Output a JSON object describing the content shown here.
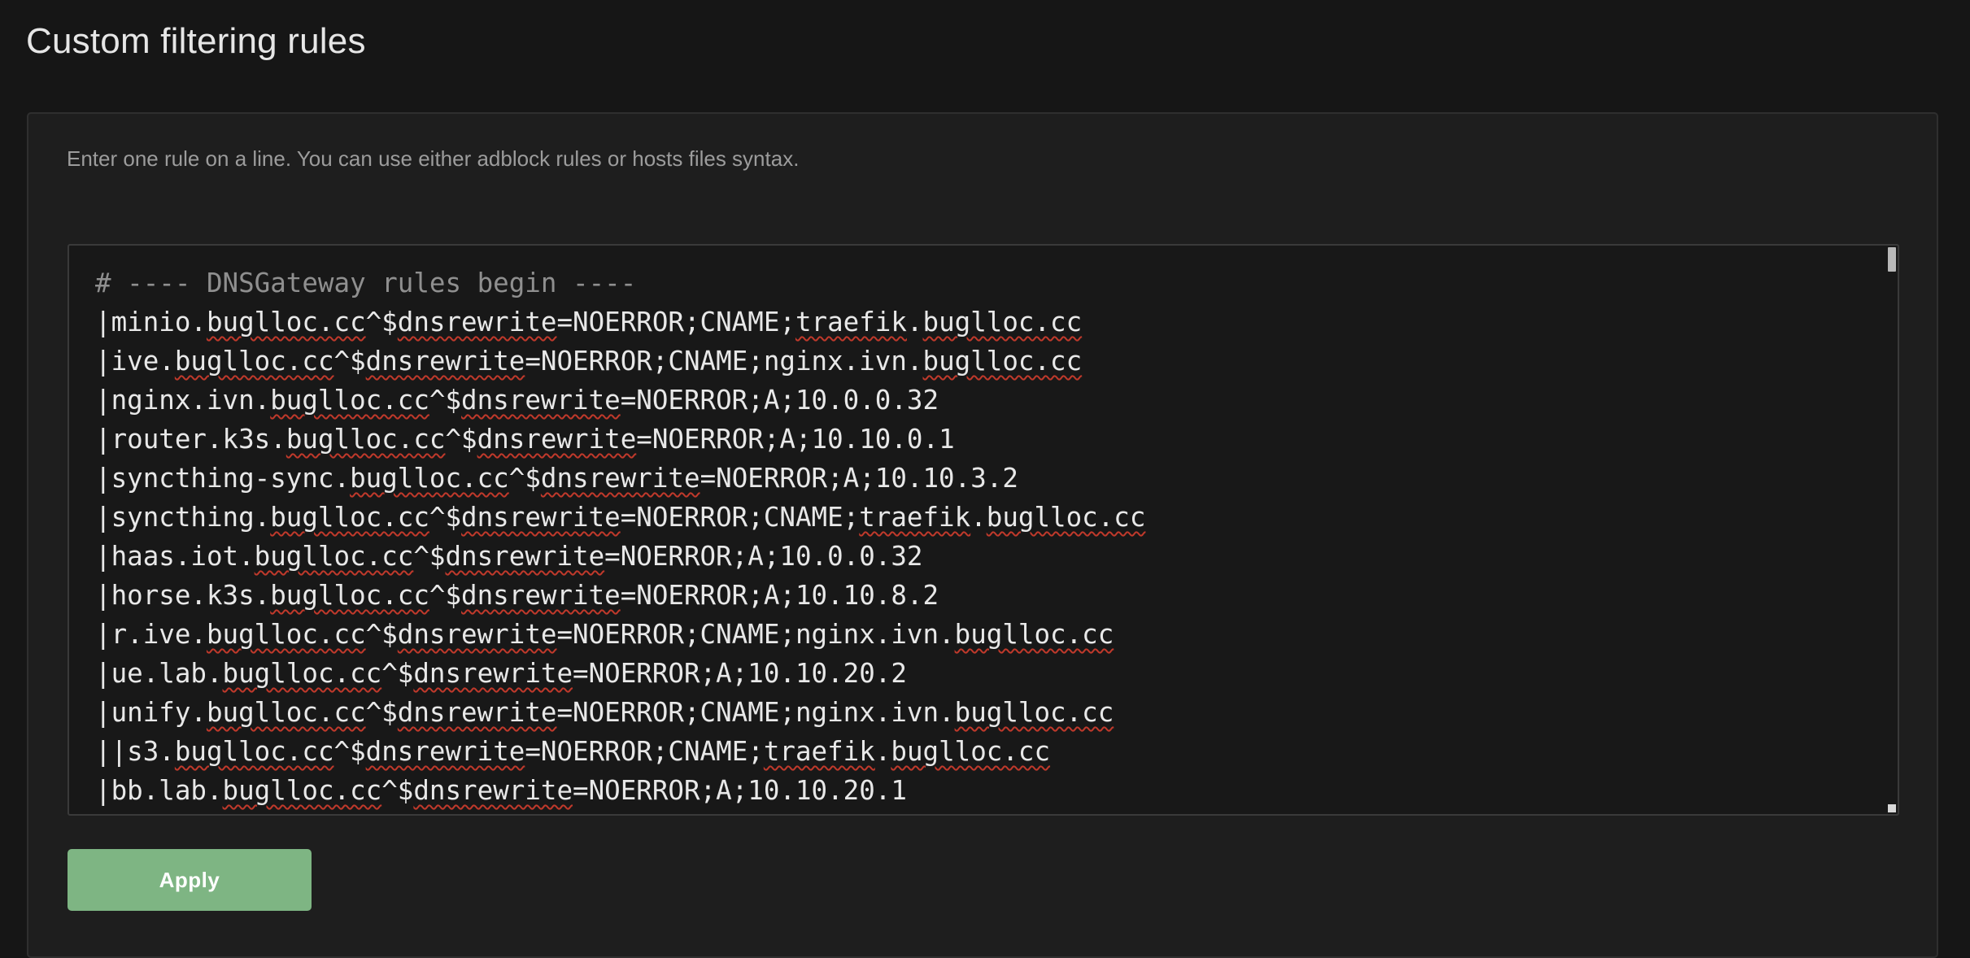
{
  "page": {
    "title": "Custom filtering rules"
  },
  "card": {
    "hint": "Enter one rule on a line. You can use either adblock rules or hosts files syntax."
  },
  "editor": {
    "lines": [
      "# ---- DNSGateway rules begin ----",
      "|minio.buglloc.cc^$dnsrewrite=NOERROR;CNAME;traefik.buglloc.cc",
      "|ive.buglloc.cc^$dnsrewrite=NOERROR;CNAME;nginx.ivn.buglloc.cc",
      "|nginx.ivn.buglloc.cc^$dnsrewrite=NOERROR;A;10.0.0.32",
      "|router.k3s.buglloc.cc^$dnsrewrite=NOERROR;A;10.10.0.1",
      "|syncthing-sync.buglloc.cc^$dnsrewrite=NOERROR;A;10.10.3.2",
      "|syncthing.buglloc.cc^$dnsrewrite=NOERROR;CNAME;traefik.buglloc.cc",
      "|haas.iot.buglloc.cc^$dnsrewrite=NOERROR;A;10.0.0.32",
      "|horse.k3s.buglloc.cc^$dnsrewrite=NOERROR;A;10.10.8.2",
      "|r.ive.buglloc.cc^$dnsrewrite=NOERROR;CNAME;nginx.ivn.buglloc.cc",
      "|ue.lab.buglloc.cc^$dnsrewrite=NOERROR;A;10.10.20.2",
      "|unify.buglloc.cc^$dnsrewrite=NOERROR;CNAME;nginx.ivn.buglloc.cc",
      "||s3.buglloc.cc^$dnsrewrite=NOERROR;CNAME;traefik.buglloc.cc",
      "|bb.lab.buglloc.cc^$dnsrewrite=NOERROR;A;10.10.20.1"
    ]
  },
  "actions": {
    "apply_label": "Apply"
  },
  "colors": {
    "background": "#161616",
    "card": "#1e1e1e",
    "editor": "#181818",
    "accent_green": "#7eb583",
    "spellcheck_red": "#c0392b"
  }
}
